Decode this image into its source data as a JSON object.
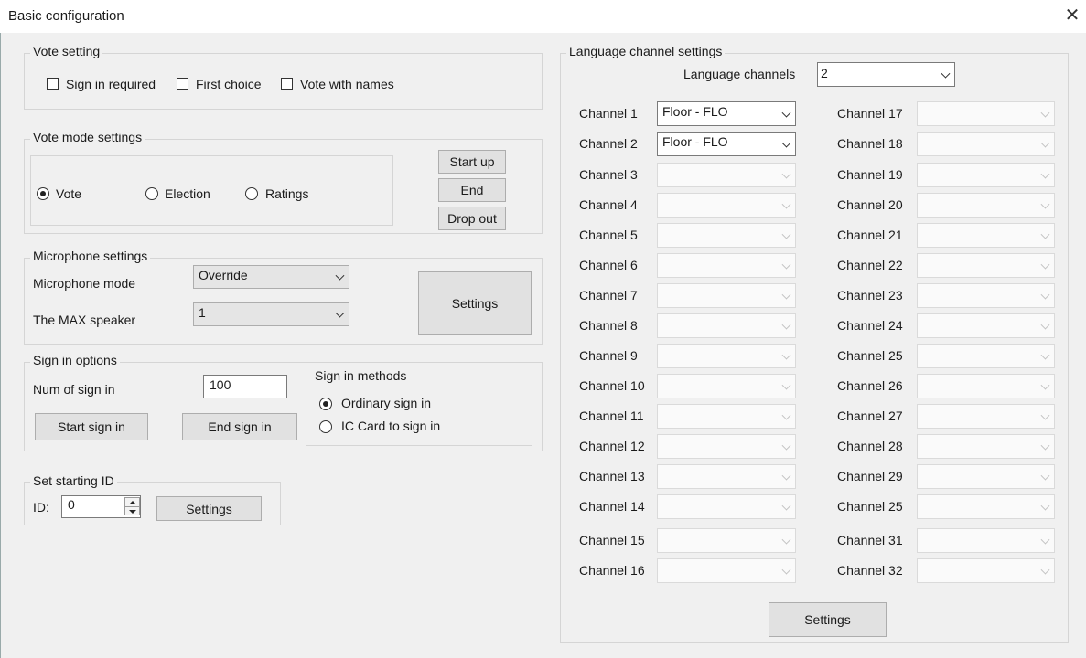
{
  "window": {
    "title": "Basic configuration",
    "close_glyph": "✕"
  },
  "vote_setting": {
    "title": "Vote setting",
    "checkboxes": [
      {
        "label": "Sign in required",
        "checked": false
      },
      {
        "label": "First choice",
        "checked": false
      },
      {
        "label": "Vote with names",
        "checked": false
      }
    ]
  },
  "vote_mode": {
    "title": "Vote mode settings",
    "radios": [
      {
        "label": "Vote",
        "selected": true
      },
      {
        "label": "Election",
        "selected": false
      },
      {
        "label": "Ratings",
        "selected": false
      }
    ],
    "buttons": {
      "start": "Start up",
      "end": "End",
      "drop": "Drop out"
    }
  },
  "microphone": {
    "title": "Microphone settings",
    "mode_label": "Microphone mode",
    "mode_value": "Override",
    "max_label": "The MAX speaker",
    "max_value": "1",
    "settings_button": "Settings"
  },
  "sign_in": {
    "title": "Sign in options",
    "num_label": "Num of sign in",
    "num_value": "100",
    "start_button": "Start sign in",
    "end_button": "End sign in",
    "methods_title": "Sign in methods",
    "methods": [
      {
        "label": "Ordinary sign in",
        "selected": true
      },
      {
        "label": "IC Card to sign in",
        "selected": false
      }
    ]
  },
  "starting_id": {
    "title": "Set starting ID",
    "id_label": "ID:",
    "id_value": "0",
    "settings_button": "Settings"
  },
  "language": {
    "title": "Language channel settings",
    "count_label": "Language channels",
    "count_value": "2",
    "left_channels": [
      {
        "label": "Channel 1",
        "value": "Floor - FLO"
      },
      {
        "label": "Channel 2",
        "value": "Floor - FLO"
      },
      {
        "label": "Channel 3",
        "value": ""
      },
      {
        "label": "Channel 4",
        "value": ""
      },
      {
        "label": "Channel 5",
        "value": ""
      },
      {
        "label": "Channel 6",
        "value": ""
      },
      {
        "label": "Channel 7",
        "value": ""
      },
      {
        "label": "Channel 8",
        "value": ""
      },
      {
        "label": "Channel 9",
        "value": ""
      },
      {
        "label": "Channel 10",
        "value": ""
      },
      {
        "label": "Channel 11",
        "value": ""
      },
      {
        "label": "Channel 12",
        "value": ""
      },
      {
        "label": "Channel 13",
        "value": ""
      },
      {
        "label": "Channel 14",
        "value": ""
      },
      {
        "label": "Channel 15",
        "value": ""
      },
      {
        "label": "Channel 16",
        "value": ""
      }
    ],
    "right_channels": [
      {
        "label": "Channel 17",
        "value": ""
      },
      {
        "label": "Channel 18",
        "value": ""
      },
      {
        "label": "Channel 19",
        "value": ""
      },
      {
        "label": "Channel 20",
        "value": ""
      },
      {
        "label": "Channel 21",
        "value": ""
      },
      {
        "label": "Channel 22",
        "value": ""
      },
      {
        "label": "Channel 23",
        "value": ""
      },
      {
        "label": "Channel 24",
        "value": ""
      },
      {
        "label": "Channel 25",
        "value": ""
      },
      {
        "label": "Channel 26",
        "value": ""
      },
      {
        "label": "Channel 27",
        "value": ""
      },
      {
        "label": "Channel 28",
        "value": ""
      },
      {
        "label": "Channel 29",
        "value": ""
      },
      {
        "label": "Channel 25",
        "value": ""
      },
      {
        "label": "Channel 31",
        "value": ""
      },
      {
        "label": "Channel 32",
        "value": ""
      }
    ],
    "settings_button": "Settings"
  }
}
